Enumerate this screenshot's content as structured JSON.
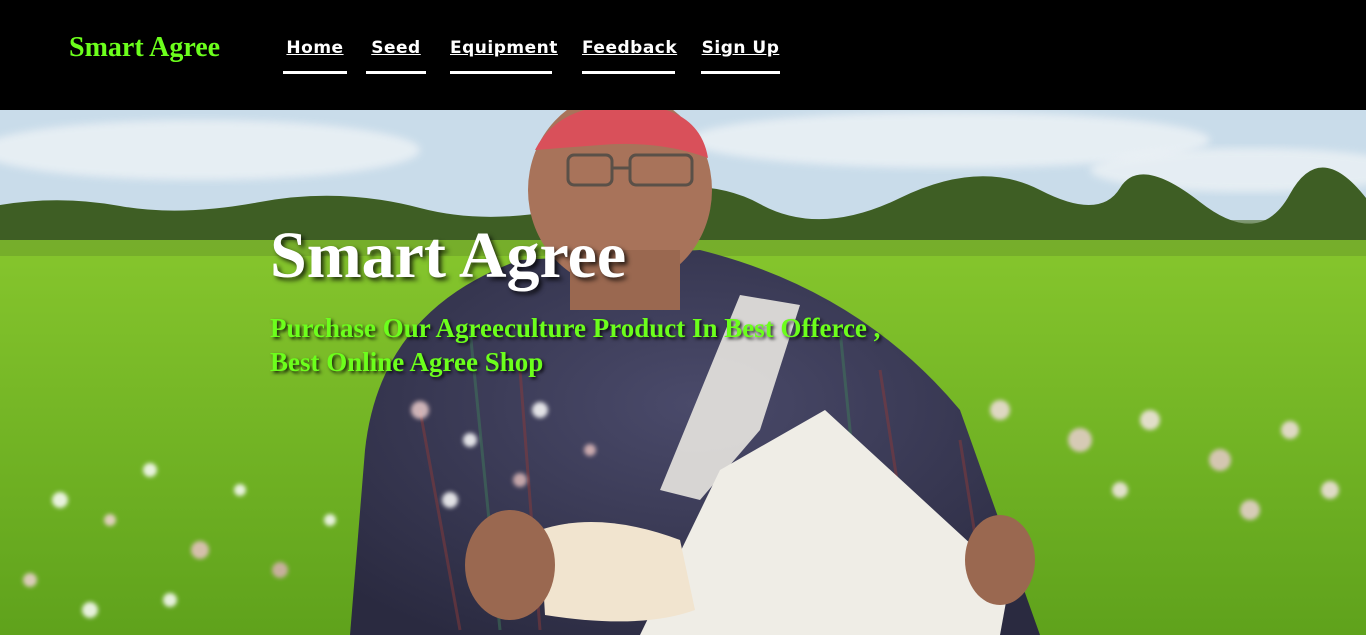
{
  "brand": "Smart Agree",
  "nav": [
    {
      "label": "Home"
    },
    {
      "label": "Seed"
    },
    {
      "label": "Equipment"
    },
    {
      "label": "Feedback"
    },
    {
      "label": "Sign Up"
    }
  ],
  "hero": {
    "title": "Smart Agree",
    "subtitle_line1": "Purchase Our Agreeculture Product In Best Offerce ,",
    "subtitle_line2": "Best Online Agree Shop",
    "image": "farmer-sowing-seeds-in-field"
  },
  "colors": {
    "navbar_bg": "#000000",
    "brand": "#6cff1c",
    "nav_text": "#ffffff",
    "subtitle": "#6cff1c"
  }
}
